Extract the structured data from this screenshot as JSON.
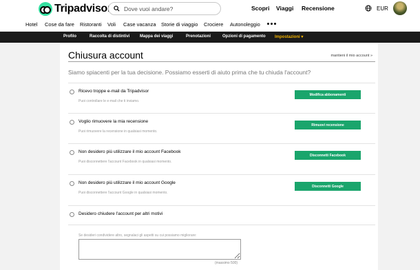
{
  "header": {
    "logo": "Tripadvisor",
    "search_placeholder": "Dove vuoi andare?",
    "links": [
      "Scopri",
      "Viaggi",
      "Recensione"
    ],
    "currency": "EUR"
  },
  "categories": [
    "Hotel",
    "Cose da fare",
    "Ristoranti",
    "Voli",
    "Case vacanza",
    "Storie di viaggio",
    "Crociere",
    "Autonoleggio"
  ],
  "account_nav": {
    "items": [
      "Profilo",
      "Raccolta di distintivi",
      "Mappa dei viaggi",
      "Prenotazioni",
      "Opzioni di pagamento",
      "Impostazioni"
    ],
    "active": "Impostazioni"
  },
  "page": {
    "title": "Chiusura account",
    "keep_link": "mantieni il mio account »",
    "subtitle": "Siamo spiacenti per la tua decisione. Possiamo esserti di aiuto prima che tu chiuda l'account?"
  },
  "options": [
    {
      "label": "Ricevo troppe e-mail da Tripadvisor",
      "hint": "Puoi controllare le e-mail che ti inviamo.",
      "button": "Modifica abbonamenti"
    },
    {
      "label": "Voglio rimuovere la mia recensione",
      "hint": "Puoi rimuovere la recensione in qualsiasi momento.",
      "button": "Rimuovi recensione"
    },
    {
      "label": "Non desidero più utilizzare il mio account Facebook",
      "hint": "Puoi disconnettere l'account Facebook in qualsiasi momento.",
      "button": "Disconnetti Facebook"
    },
    {
      "label": "Non desidero più utilizzare il mio account Google",
      "hint": "Puoi disconnettere l'account Google in qualsiasi momento.",
      "button": "Disconnetti Google"
    },
    {
      "label": "Desidero chiudere l'account per altri motivi",
      "hint": "",
      "button": ""
    }
  ],
  "feedback": {
    "hint": "Se desideri condividere altro, segnalaci gli aspetti su cui possiamo migliorare:",
    "max": "(massimo 500)"
  },
  "colors": {
    "brand_green": "#34e0a1",
    "button_green": "#1aa56c",
    "active_nav": "#f2b200"
  }
}
